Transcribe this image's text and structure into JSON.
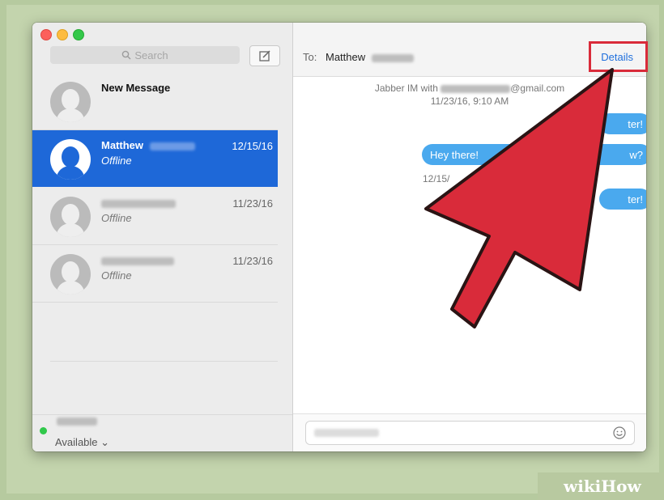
{
  "search": {
    "placeholder": "Search"
  },
  "new_message": {
    "name": "New Message"
  },
  "conversations": [
    {
      "name": "Matthew",
      "status": "Offline",
      "date": "12/15/16",
      "selected": true
    },
    {
      "name": "",
      "status": "Offline",
      "date": "11/23/16",
      "selected": false
    },
    {
      "name": "",
      "status": "Offline",
      "date": "11/23/16",
      "selected": false
    }
  ],
  "account_status": {
    "text": "Available ⌄",
    "dot_color": "#30c84a"
  },
  "header": {
    "to_label": "To:",
    "to_name": "Matthew",
    "details_label": "Details"
  },
  "messages": {
    "service_line_prefix": "Jabber IM with",
    "service_line_suffix": "@gmail.com",
    "timestamp": "11/23/16, 9:10 AM",
    "bubble_1": "ter!",
    "bubble_2_start": "Hey there!",
    "bubble_2_end": "w?",
    "timestamp_2": "12/15/",
    "bubble_3": "ter!"
  },
  "input": {
    "placeholder": ""
  },
  "watermark": {
    "wiki": "wiki",
    "how": "How"
  },
  "colors": {
    "accent": "#1e68d8",
    "bubble": "#4aa9ee",
    "annotation": "#d92b3a"
  },
  "icons": [
    "search-icon",
    "compose-icon",
    "emoji-icon",
    "arrow-annotation"
  ]
}
